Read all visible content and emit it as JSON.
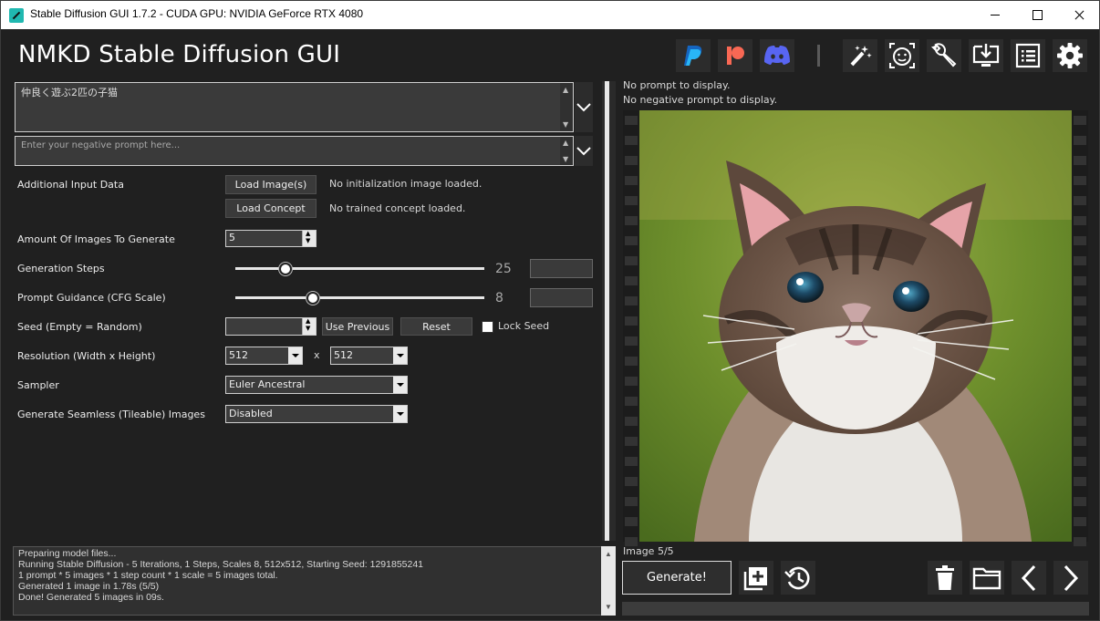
{
  "window": {
    "title": "Stable Diffusion GUI 1.7.2 - CUDA GPU: NVIDIA GeForce RTX 4080"
  },
  "header": {
    "app_title": "NMKD Stable Diffusion GUI",
    "icons": [
      "paypal-icon",
      "patreon-icon",
      "discord-icon",
      "magic-wand-icon",
      "face-icon",
      "wrench-icon",
      "install-icon",
      "list-icon",
      "gear-icon"
    ],
    "colors": {
      "paypal": "#1e88e5",
      "patreon": "#f96854",
      "discord": "#5865f2"
    }
  },
  "prompt": {
    "value": "仲良く遊ぶ2匹の子猫"
  },
  "negative_prompt": {
    "placeholder": "Enter your negative prompt here..."
  },
  "settings": {
    "additional_input_label": "Additional Input Data",
    "load_images_label": "Load Image(s)",
    "load_images_status": "No initialization image loaded.",
    "load_concept_label": "Load Concept",
    "load_concept_status": "No trained concept loaded.",
    "amount_label": "Amount Of Images To Generate",
    "amount_value": "5",
    "steps_label": "Generation Steps",
    "steps_value": "25",
    "steps_fraction": 0.2,
    "cfg_label": "Prompt Guidance (CFG Scale)",
    "cfg_value": "8",
    "cfg_fraction": 0.31,
    "seed_label": "Seed (Empty = Random)",
    "seed_value": "",
    "use_previous_label": "Use Previous",
    "reset_label": "Reset",
    "lock_seed_label": "Lock Seed",
    "lock_seed_checked": false,
    "resolution_label": "Resolution (Width x Height)",
    "width_value": "512",
    "x_label": "x",
    "height_value": "512",
    "sampler_label": "Sampler",
    "sampler_value": "Euler Ancestral",
    "seamless_label": "Generate Seamless (Tileable) Images",
    "seamless_value": "Disabled"
  },
  "preview": {
    "prompt_info": "No prompt to display.",
    "negative_prompt_info": "No negative prompt to display.",
    "image_count": "Image 5/5"
  },
  "log": {
    "lines": [
      "Preparing model files...",
      "Running Stable Diffusion - 5 Iterations, 1 Steps, Scales 8, 512x512, Starting Seed: 1291855241",
      "1 prompt * 5 images * 1 step count * 1 scale = 5 images total.",
      "Generated 1 image in 1.78s (5/5)",
      "Done! Generated 5 images in 09s."
    ]
  },
  "actions": {
    "generate_label": "Generate!",
    "icons": [
      "add-to-queue-icon",
      "history-icon",
      "delete-icon",
      "folder-icon",
      "previous-icon",
      "next-icon"
    ]
  },
  "progress": {
    "fraction": 0
  }
}
